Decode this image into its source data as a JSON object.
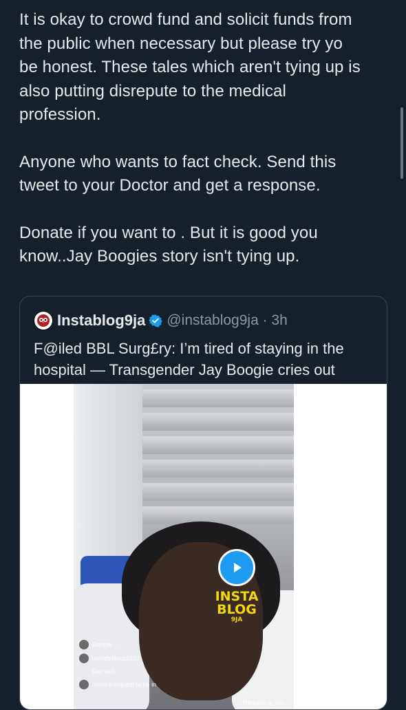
{
  "tweet": {
    "paragraphs": [
      "It is okay to crowd fund and solicit funds from\nthe public when necessary but please try yo\nbe honest. These tales which aren't tying up is\nalso putting disrepute to the medical\nprofession.",
      "Anyone who wants to fact check. Send this\ntweet to your Doctor and get a response.",
      "Donate if you want to . But it is good you\nknow..Jay Boogies story isn't tying up."
    ]
  },
  "quote": {
    "display_name": "Instablog9ja",
    "handle_time": "@instablog9ja · 3h",
    "text": "F@iled BBL Surg£ry: I’m tired of staying in the\nhospital — Transgender Jay Boogie cries out",
    "verified_icon": "verified-badge-icon",
    "avatar_icon": "owl-logo-icon"
  },
  "media": {
    "play_icon": "play-icon",
    "watermark_line1": "INSTA",
    "watermark_line2": "BLOG",
    "watermark_line3": "9JA",
    "comments": [
      "Boogie ...",
      "denizbillionz2231",
      "Get well",
      "Send a request to be in"
    ],
    "request_join": "Request to join"
  },
  "colors": {
    "background": "#15202b",
    "text": "#e7e9ea",
    "secondary_text": "#8b98a5",
    "accent": "#1d9bf0",
    "border": "#38444d"
  }
}
